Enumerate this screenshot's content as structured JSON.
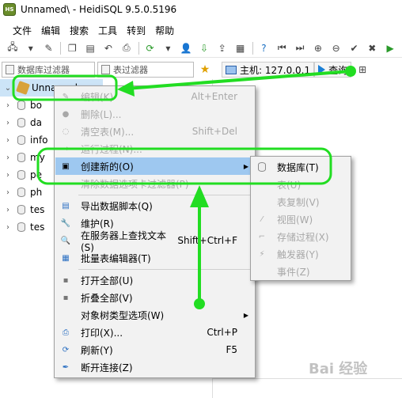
{
  "window": {
    "title": "Unnamed\\ - HeidiSQL 9.5.0.5196",
    "app_icon_text": "HS"
  },
  "menu": [
    "文件",
    "编辑",
    "搜索",
    "工具",
    "转到",
    "帮助"
  ],
  "filters": {
    "db_filter_placeholder": "数据库过滤器",
    "table_filter_placeholder": "表过滤器"
  },
  "tabs": {
    "host": "主机: 127.0.0.1",
    "query": "查询"
  },
  "tree": {
    "root": "Unnamed",
    "items": [
      "bo",
      "da",
      "info",
      "my",
      "pe",
      "ph",
      "tes",
      "tes"
    ]
  },
  "context_menu": [
    {
      "label": "编辑(K)",
      "shortcut": "Alt+Enter",
      "disabled": true,
      "icon": "pencil-icon"
    },
    {
      "label": "删除(L)...",
      "shortcut": "",
      "disabled": true,
      "icon": "delete-icon"
    },
    {
      "label": "清空表(M)...",
      "shortcut": "Shift+Del",
      "disabled": true,
      "icon": "clear-icon"
    },
    {
      "label": "运行过程(N)...",
      "shortcut": "",
      "disabled": true,
      "icon": "run-icon"
    },
    {
      "label": "创建新的(O)",
      "shortcut": "",
      "disabled": false,
      "active": true,
      "submenu": true,
      "icon": "create-icon"
    },
    {
      "label": "清除数据选项卡过滤器(P)",
      "shortcut": "",
      "disabled": true,
      "icon": "filter-clear-icon"
    },
    {
      "label": "导出数据脚本(Q)",
      "shortcut": "",
      "disabled": false,
      "icon": "export-icon"
    },
    {
      "label": "维护(R)",
      "shortcut": "",
      "disabled": false,
      "icon": "wrench-icon"
    },
    {
      "label": "在服务器上查找文本(S)",
      "shortcut": "Shift+Ctrl+F",
      "disabled": false,
      "icon": "search-icon"
    },
    {
      "label": "批量表编辑器(T)",
      "shortcut": "",
      "disabled": false,
      "icon": "bulk-edit-icon"
    },
    {
      "label": "打开全部(U)",
      "shortcut": "",
      "disabled": false,
      "icon": "expand-icon"
    },
    {
      "label": "折叠全部(V)",
      "shortcut": "",
      "disabled": false,
      "icon": "collapse-icon"
    },
    {
      "label": "对象树类型选项(W)",
      "shortcut": "",
      "disabled": false,
      "submenu": true,
      "icon": ""
    },
    {
      "label": "打印(X)...",
      "shortcut": "Ctrl+P",
      "disabled": false,
      "icon": "print-icon"
    },
    {
      "label": "刷新(Y)",
      "shortcut": "F5",
      "disabled": false,
      "icon": "refresh-icon"
    },
    {
      "label": "断开连接(Z)",
      "shortcut": "",
      "disabled": false,
      "icon": "disconnect-icon"
    }
  ],
  "submenu": [
    {
      "label": "数据库(T)",
      "disabled": false,
      "icon": "database-icon"
    },
    {
      "label": "表(U)",
      "disabled": true,
      "icon": ""
    },
    {
      "label": "表复制(V)",
      "disabled": true,
      "icon": ""
    },
    {
      "label": "视图(W)",
      "disabled": true,
      "icon": "view-icon"
    },
    {
      "label": "存储过程(X)",
      "disabled": true,
      "icon": "procedure-icon"
    },
    {
      "label": "触发器(Y)",
      "disabled": true,
      "icon": "trigger-icon"
    },
    {
      "label": "事件(Z)",
      "disabled": true,
      "icon": ""
    }
  ],
  "watermark": "Bai 经验",
  "colors": {
    "annotation": "#22dd22",
    "menu_active": "#9ec8f0"
  }
}
